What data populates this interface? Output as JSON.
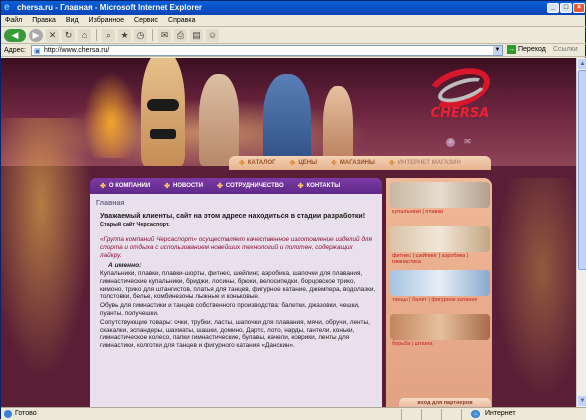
{
  "window": {
    "title": "chersa.ru - Главная - Microsoft Internet Explorer",
    "controls": [
      "_",
      "□",
      "×"
    ]
  },
  "menu": [
    "Файл",
    "Правка",
    "Вид",
    "Избранное",
    "Сервис",
    "Справка"
  ],
  "address": {
    "label": "Адрес:",
    "url": "http://www.chersa.ru/",
    "go": "Переход",
    "links": "Ссылки"
  },
  "site": {
    "logo": "CHERSA",
    "topnav": [
      "КАТАЛОГ",
      "ЦЕНЫ",
      "МАГАЗИНЫ",
      "ИНТЕРНЕТ МАГАЗИН"
    ],
    "leftnav": [
      "О КОМПАНИИ",
      "НОВОСТИ",
      "СОТРУДНИЧЕСТВО",
      "КОНТАКТЫ"
    ],
    "content_title": "Главная",
    "welcome": "Уважаемый клиенты, сайт на этом адресе находиться в стадии разработки!",
    "old_site": "Старый сайт Черсаспорт.",
    "quote": "«Группа компаний Черсаспорт» осуществляет качественное изготовление изделий для спорта и отдыха с использованием новейших технологий и полотен, содержащих лайкру.",
    "namely": "А именно:",
    "para1": "Купальники, плавки, плавки-шорты, фитнес, шейпинг, аэробика, шапочки для плавания, гимнастические купальники, бриджи, лосины, брюки, велосипедки, борцовское трико, кимоно, трико для штангистов, платья для танцев, фигурное катание, джемпера, водолазки, толстовки, белье, комбинезоны лыжные и коньковые.",
    "para2": "Обувь для гимнастики и танцев собственного производства: балетки, джазовки, чешки, пуанты, получешки.",
    "para3": "Сопутствующие товары: очки, трубки, ласты, шапочки для плавания, мячи, обручи, ленты, скакалки, эспандеры, шахматы, шашки, домино, Дартс, лото, нарды, гантели, коньки, гимнастическое колесо, папки гимнастические, булавы, качели, коврики, ленты для гимнастики, колготки для танцев и фигурного катания «Данскин».",
    "sidebar": [
      "купальники | плавки",
      "фитнес | шейпинг | аэробика | гимнастика",
      "танцы | балет | фигурное катание",
      "борьба | штанга"
    ],
    "partners": "вход для партнеров"
  },
  "status": {
    "text": "Готово",
    "zone": "Интернет"
  }
}
